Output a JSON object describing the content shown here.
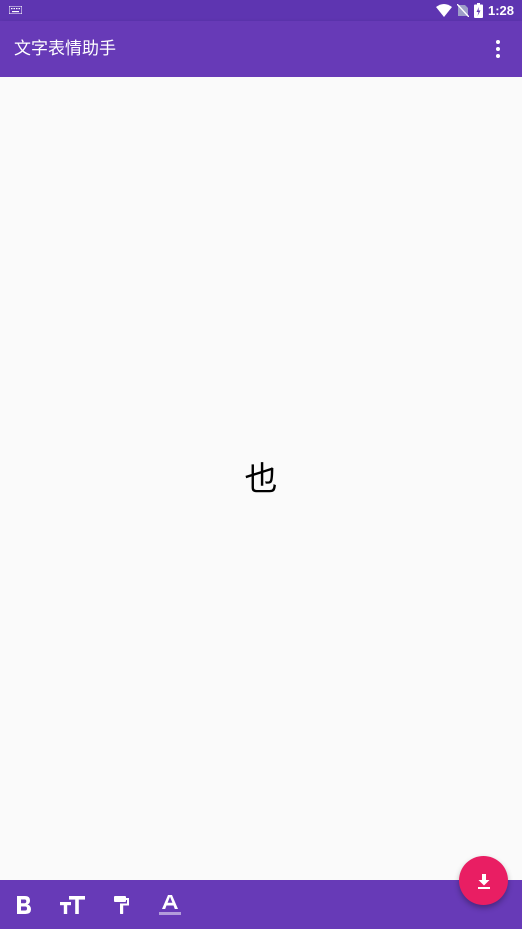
{
  "status_bar": {
    "time": "1:28",
    "icons": [
      "keyboard-icon",
      "wifi-icon",
      "no-sim-icon",
      "battery-charging-icon"
    ]
  },
  "app_bar": {
    "title": "文字表情助手",
    "menu_icon": "more-vert-icon"
  },
  "canvas": {
    "text": "也"
  },
  "toolbar": {
    "items": [
      {
        "icon": "format-bold-icon"
      },
      {
        "icon": "format-size-icon"
      },
      {
        "icon": "format-paint-icon"
      },
      {
        "icon": "format-color-text-icon"
      }
    ]
  },
  "fab": {
    "icon": "download-icon"
  },
  "colors": {
    "status_bar": "#5E35B1",
    "primary": "#673AB7",
    "accent": "#E91E63",
    "background": "#FAFAFA",
    "text_color_indicator": "#B39DDB"
  }
}
